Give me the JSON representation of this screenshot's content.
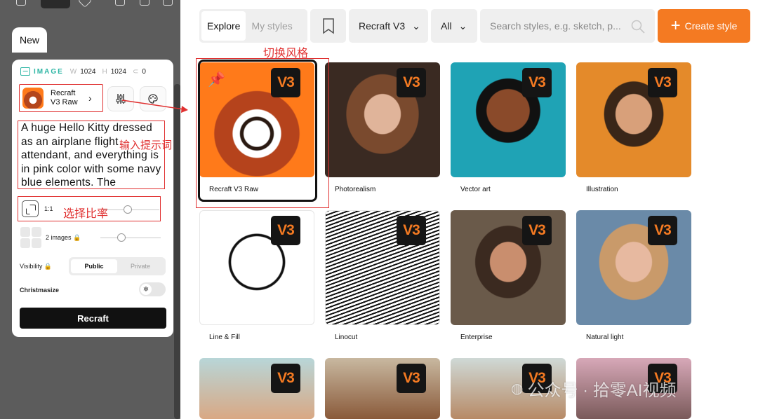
{
  "panel": {
    "new_tab": "New",
    "image_label": "IMAGE",
    "w_key": "W",
    "w_val": "1024",
    "h_key": "H",
    "h_val": "1024",
    "seed_val": "0",
    "model_name": "Recraft V3 Raw",
    "prompt": "A huge Hello Kitty dressed as an airplane flight attendant, and everything is in pink color with some navy blue elements. The",
    "ratio": "1:1",
    "images_count": "2 images",
    "visibility_label": "Visibility",
    "visibility_options": [
      "Public",
      "Private"
    ],
    "visibility_selected": "Public",
    "christmasize_label": "Christmasize",
    "recraft_button": "Recraft"
  },
  "filter_bar": {
    "tabs": [
      "Explore",
      "My styles"
    ],
    "active_tab": "Explore",
    "model_dropdown": "Recraft V3",
    "category_dropdown": "All",
    "search_placeholder": "Search styles, e.g. sketch, p...",
    "create_button": "Create style"
  },
  "badge_text": "V3",
  "styles": [
    {
      "label": "Recraft V3 Raw"
    },
    {
      "label": "Photorealism"
    },
    {
      "label": "Vector art"
    },
    {
      "label": "Illustration"
    },
    {
      "label": "Line & Fill"
    },
    {
      "label": "Linocut"
    },
    {
      "label": "Enterprise"
    },
    {
      "label": "Natural light"
    },
    {
      "label": ""
    },
    {
      "label": ""
    },
    {
      "label": ""
    },
    {
      "label": ""
    }
  ],
  "annotations": {
    "switch_style": "切换风格",
    "enter_prompt": "输入提示词",
    "select_ratio": "选择比率"
  },
  "watermark": "公众号 · 拾零AI视频",
  "colors": {
    "accent": "#f47a22",
    "annotation": "#e03030",
    "brand_teal": "#2fb6a5"
  }
}
